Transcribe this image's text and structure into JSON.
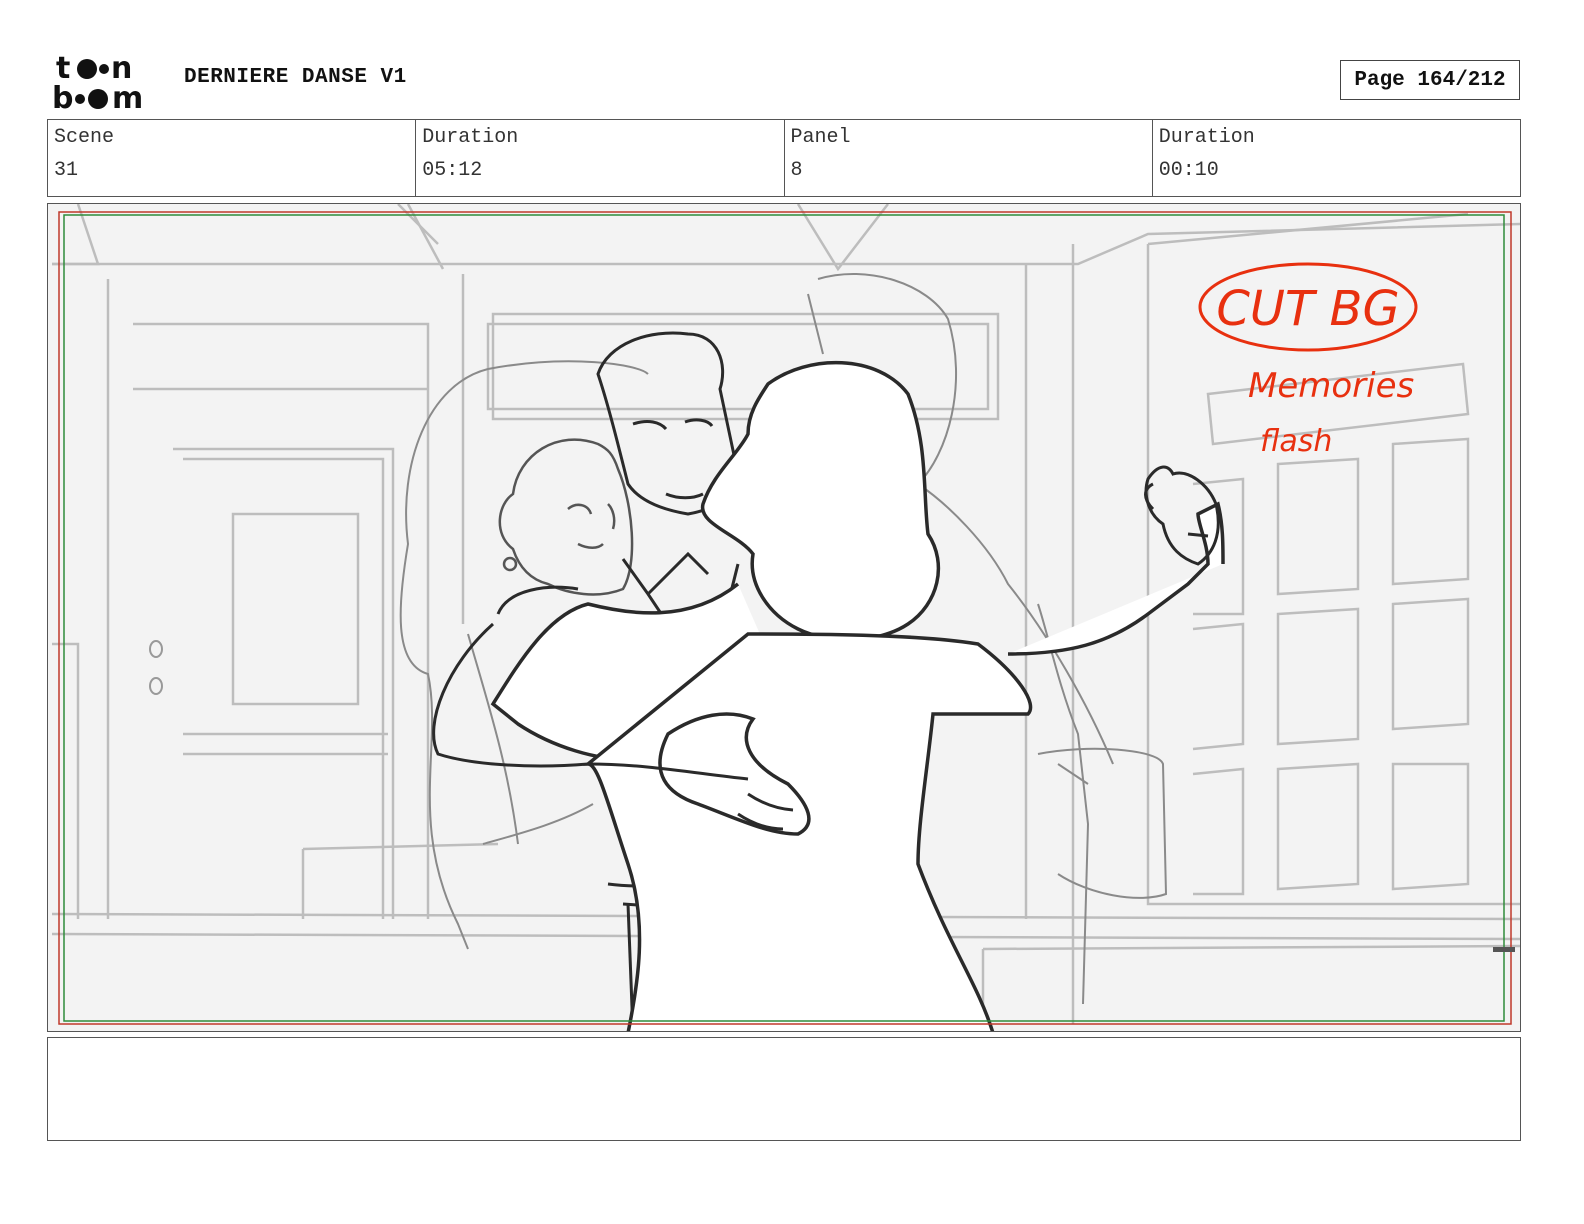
{
  "header": {
    "logo_alt": "toon boom",
    "project_title": "DERNIERE DANSE V1",
    "page_label": "Page 164/212"
  },
  "info": [
    {
      "label": "Scene",
      "value": "31"
    },
    {
      "label": "Duration",
      "value": "05:12"
    },
    {
      "label": "Panel",
      "value": "8"
    },
    {
      "label": "Duration",
      "value": "00:10"
    }
  ],
  "panel": {
    "annotations": {
      "cut_bg": "CUT BG",
      "memories": "Memories",
      "flash": "flash"
    },
    "annotation_color": "#e8300f",
    "safe_frame_colors": [
      "#c0392b",
      "#2e8b3a"
    ]
  },
  "notes": {
    "text": ""
  }
}
